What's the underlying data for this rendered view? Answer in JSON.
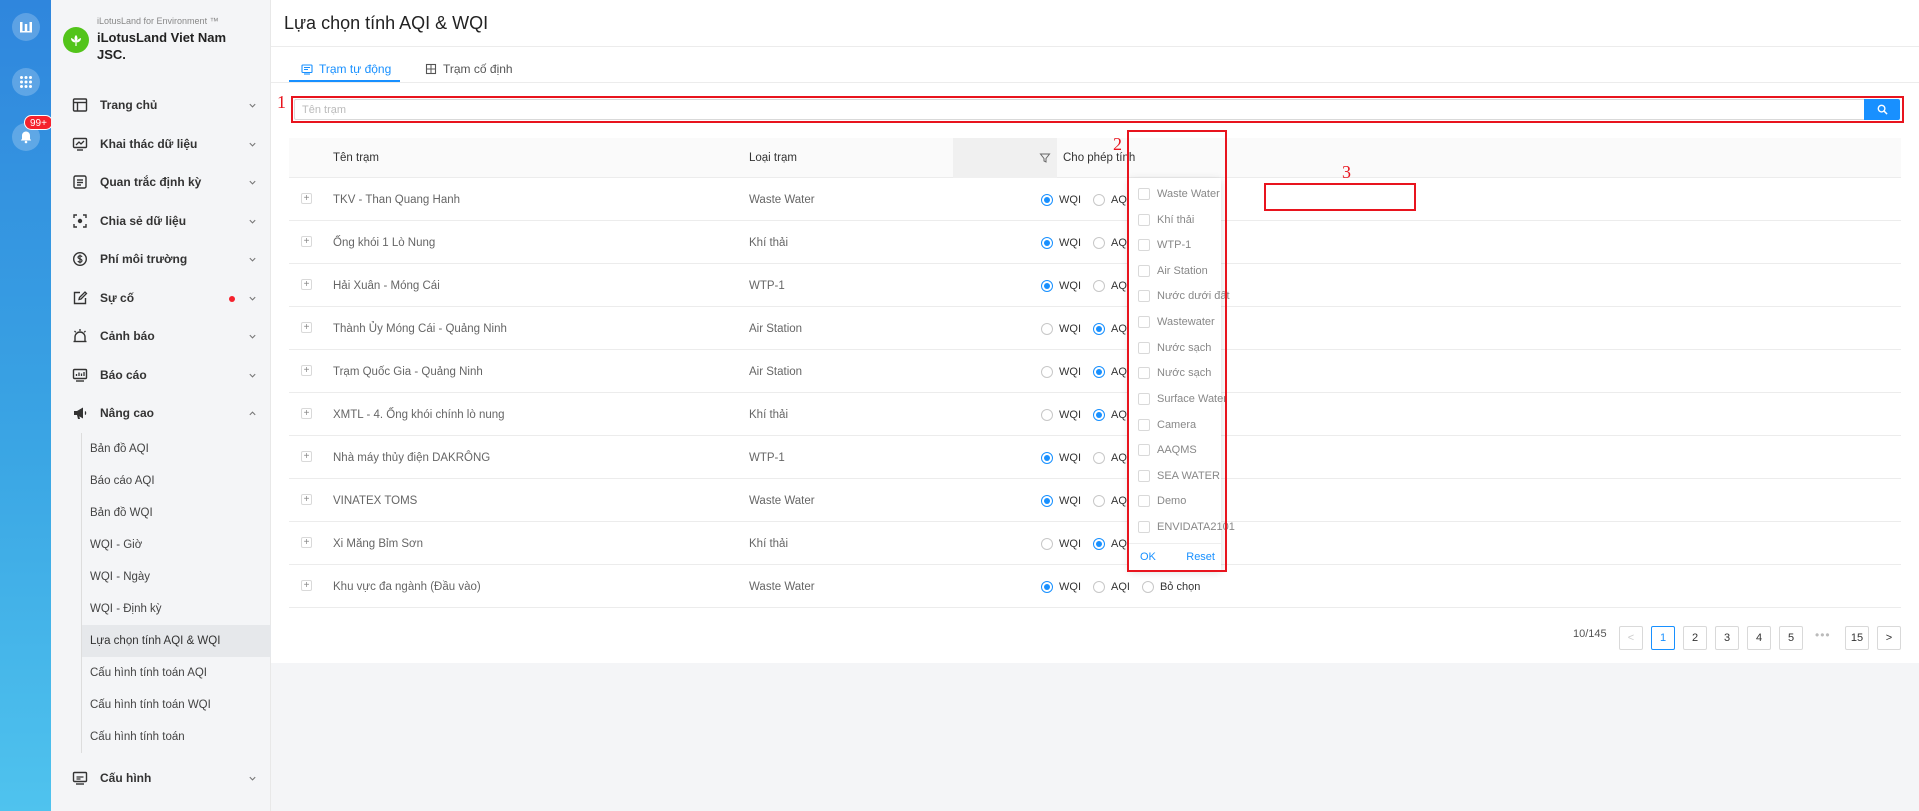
{
  "rail": {
    "badge": "99+",
    "items": [
      "logo-icon",
      "apps-grid-icon",
      "notification-bell-icon"
    ]
  },
  "sidebar": {
    "brand_sub": "iLotusLand for Environment ™",
    "brand_name": "iLotusLand Viet Nam JSC.",
    "menu": [
      {
        "label": "Trang chủ",
        "icon": "home-layout-icon"
      },
      {
        "label": "Khai thác dữ liệu",
        "icon": "monitor-data-icon"
      },
      {
        "label": "Quan trắc định kỳ",
        "icon": "list-document-icon"
      },
      {
        "label": "Chia sẻ dữ liệu",
        "icon": "share-focus-icon"
      },
      {
        "label": "Phí môi trường",
        "icon": "dollar-icon"
      },
      {
        "label": "Sự cố",
        "icon": "edit-incident-icon"
      },
      {
        "label": "Cảnh báo",
        "icon": "alarm-icon"
      },
      {
        "label": "Báo cáo",
        "icon": "report-icon"
      },
      {
        "label": "Nâng cao",
        "icon": "megaphone-icon"
      }
    ],
    "submenu": [
      "Bản đồ AQI",
      "Báo cáo AQI",
      "Bản đồ WQI",
      "WQI - Giờ",
      "WQI - Ngày",
      "WQI - Định kỳ",
      "Lựa chọn tính AQI & WQI",
      "Cấu hình tính toán AQI",
      "Cấu hình tính toán WQI",
      "Cấu hình tính toán"
    ],
    "active_submenu": "Lựa chọn tính AQI & WQI",
    "config": {
      "label": "Cấu hình",
      "icon": "config-monitor-icon"
    }
  },
  "page": {
    "title": "Lựa chọn tính AQI & WQI",
    "tabs": [
      {
        "label": "Trạm tự động",
        "active": true
      },
      {
        "label": "Trạm cố định",
        "active": false
      }
    ],
    "search_placeholder": "Tên trạm"
  },
  "table": {
    "headers": {
      "name": "Tên trạm",
      "type": "Loại trạm",
      "calc": "Cho phép tính"
    },
    "radio_labels": [
      "WQI",
      "AQI",
      "Bỏ chọn"
    ],
    "rows": [
      {
        "name": "TKV - Than Quang Hanh",
        "type": "Waste Water",
        "selected": "WQI"
      },
      {
        "name": "Ống khói 1 Lò Nung",
        "type": "Khí thải",
        "selected": "WQI"
      },
      {
        "name": "Hải Xuân - Móng Cái",
        "type": "WTP-1",
        "selected": "WQI"
      },
      {
        "name": "Thành Ủy Móng Cái - Quảng Ninh",
        "type": "Air Station",
        "selected": "AQI"
      },
      {
        "name": "Trạm Quốc Gia - Quảng Ninh",
        "type": "Air Station",
        "selected": "AQI"
      },
      {
        "name": "XMTL - 4. Ống khói chính lò nung",
        "type": "Khí thải",
        "selected": "AQI"
      },
      {
        "name": "Nhà máy thủy điện DAKRÔNG",
        "type": "WTP-1",
        "selected": "WQI"
      },
      {
        "name": "VINATEX TOMS",
        "type": "Waste Water",
        "selected": "WQI"
      },
      {
        "name": "Xi Măng Bỉm Sơn",
        "type": "Khí thải",
        "selected": "AQI"
      },
      {
        "name": "Khu vực đa ngành (Đầu vào)",
        "type": "Waste Water",
        "selected": "WQI"
      }
    ]
  },
  "filter": {
    "options": [
      "Waste Water",
      "Khí thải",
      "WTP-1",
      "Air Station",
      "Nước dưới đất",
      "Wastewater",
      "Nước sạch",
      "Nước sạch",
      "Surface Water",
      "Camera",
      "AAQMS",
      "SEA WATER",
      "Demo",
      "ENVIDATA2101"
    ],
    "ok": "OK",
    "reset": "Reset"
  },
  "annotations": [
    "1",
    "2",
    "3"
  ],
  "pagination": {
    "total": "10/145",
    "pages": [
      "1",
      "2",
      "3",
      "4",
      "5"
    ],
    "last": "15",
    "ellipsis": "•••",
    "current": "1",
    "prev": "<",
    "next": ">"
  },
  "colors": {
    "primary": "#1890ff",
    "annotation": "#e8141e",
    "rail_top": "#2f86dd",
    "rail_bottom": "#4fc3ee"
  }
}
